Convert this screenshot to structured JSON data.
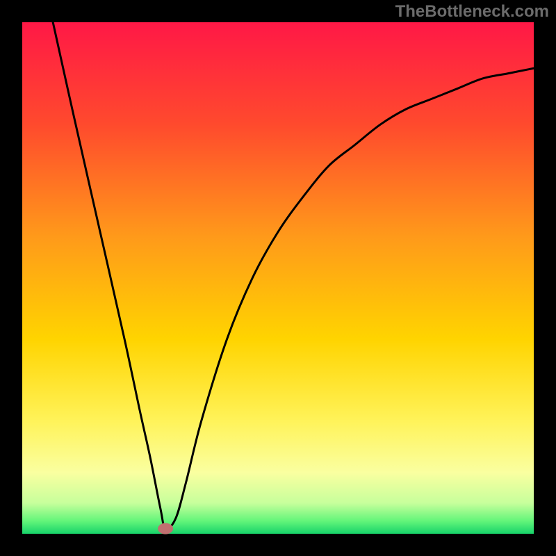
{
  "watermark": "TheBottleneck.com",
  "chart_data": {
    "type": "line",
    "title": "",
    "xlabel": "",
    "ylabel": "",
    "xlim": [
      0,
      100
    ],
    "ylim": [
      0,
      100
    ],
    "grid": false,
    "series": [
      {
        "name": "bottleneck-curve",
        "x": [
          6,
          10,
          15,
          20,
          23,
          25,
          27,
          28,
          30,
          32,
          35,
          40,
          45,
          50,
          55,
          60,
          65,
          70,
          75,
          80,
          85,
          90,
          95,
          100
        ],
        "values": [
          100,
          82,
          60,
          38,
          24,
          15,
          5,
          1,
          3,
          10,
          22,
          38,
          50,
          59,
          66,
          72,
          76,
          80,
          83,
          85,
          87,
          89,
          90,
          91
        ]
      }
    ],
    "marker": {
      "x": 28,
      "y": 1
    },
    "gradient_stops": [
      {
        "pos": 0.0,
        "color": "#ff1846"
      },
      {
        "pos": 0.2,
        "color": "#ff4a2d"
      },
      {
        "pos": 0.42,
        "color": "#ff9a1a"
      },
      {
        "pos": 0.62,
        "color": "#ffd400"
      },
      {
        "pos": 0.78,
        "color": "#fff35a"
      },
      {
        "pos": 0.88,
        "color": "#faffa0"
      },
      {
        "pos": 0.94,
        "color": "#c7ff9c"
      },
      {
        "pos": 0.975,
        "color": "#63f57a"
      },
      {
        "pos": 1.0,
        "color": "#17d36a"
      }
    ],
    "frame_color": "#000000",
    "curve_color": "#000000",
    "marker_color": "#c07070"
  }
}
